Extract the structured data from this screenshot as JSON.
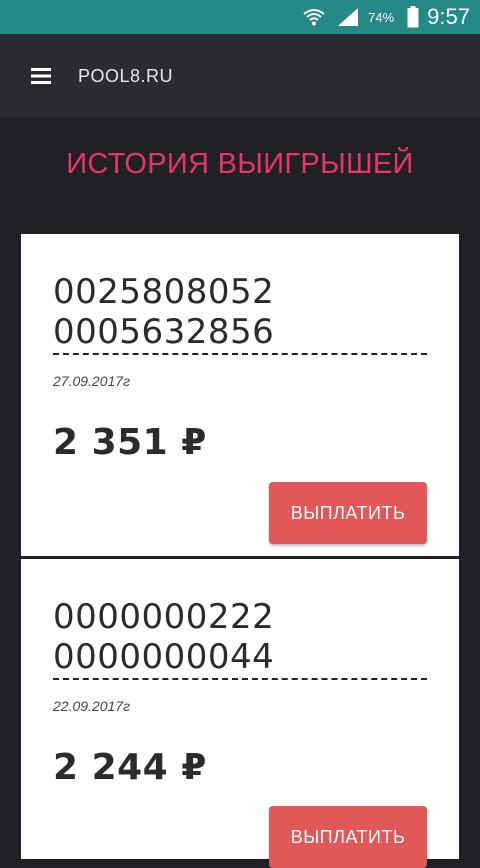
{
  "status_bar": {
    "battery_percent": "74%",
    "time": "9:57"
  },
  "app_bar": {
    "title": "POOL8.RU"
  },
  "page": {
    "title": "ИСТОРИЯ ВЫИГРЫШЕЙ"
  },
  "cards": [
    {
      "code_line_1": "0025808052",
      "code_line_2": "0005632856",
      "date": "27.09.2017г",
      "amount": "2 351 ₽",
      "button_label": "ВЫПЛАТИТЬ"
    },
    {
      "code_line_1": "0000000222",
      "code_line_2": "0000000044",
      "date": "22.09.2017г",
      "amount": "2 244 ₽",
      "button_label": "ВЫПЛАТИТЬ"
    }
  ],
  "colors": {
    "status_bar": "#258a86",
    "app_bar": "#2a2c30",
    "background": "#1f2124",
    "title_accent": "#e8336b",
    "button": "#e25758"
  }
}
